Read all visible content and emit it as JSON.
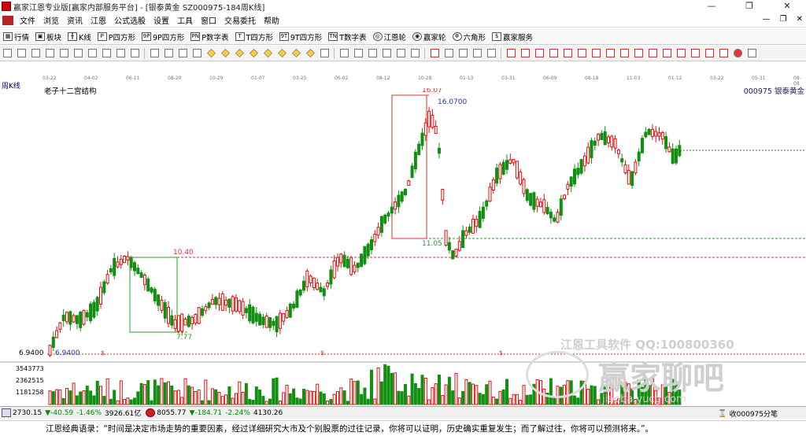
{
  "window": {
    "title": "赢家江恩专业版[赢家内部服务平台] - [银泰黄金  SZ000975-184周K线]",
    "controls": [
      "—",
      "❐",
      "✕"
    ]
  },
  "menu": {
    "items": [
      "文件",
      "浏览",
      "资讯",
      "江恩",
      "公式选股",
      "设置",
      "工具",
      "窗口",
      "交易委托",
      "帮助"
    ],
    "mdi_controls": [
      "—",
      "❐",
      "✕"
    ]
  },
  "toolbar_main": [
    {
      "icon": "grid-icon",
      "glyph": "▦",
      "label": "行情"
    },
    {
      "icon": "blocks-icon",
      "glyph": "▣",
      "label": "板块"
    },
    {
      "icon": "candle-icon",
      "glyph": "╫",
      "label": "K线"
    },
    {
      "icon": "p-square-icon",
      "glyph": "P",
      "label": "P四方形"
    },
    {
      "icon": "9p-square-icon",
      "glyph": "9P",
      "label": "9P四方形"
    },
    {
      "icon": "pn-table-icon",
      "glyph": "PN",
      "label": "P数字表"
    },
    {
      "icon": "t-square-icon",
      "glyph": "T",
      "label": "T四方形"
    },
    {
      "icon": "9t-square-icon",
      "glyph": "9T",
      "label": "9T四方形"
    },
    {
      "icon": "tn-table-icon",
      "glyph": "TN",
      "label": "T数字表"
    },
    {
      "icon": "gann-wheel-icon",
      "glyph": "◎",
      "label": "江恩轮"
    },
    {
      "icon": "winner-wheel-icon",
      "glyph": "◉",
      "label": "赢家轮"
    },
    {
      "icon": "hexagon-icon",
      "glyph": "✲",
      "label": "六角形"
    },
    {
      "icon": "dollar-icon",
      "glyph": "$",
      "label": "赢家服务"
    }
  ],
  "toolbar_draw": [
    "period-icon",
    "zoom-icon",
    "copy-icon",
    "paste-icon",
    "cut-icon",
    "undo-icon",
    "ruler-icon",
    "a-icon",
    "chart-icon",
    "flag-icon",
    "first-icon",
    "last-icon",
    "prev-icon",
    "next-icon",
    "diamond1-icon",
    "diamond2-icon",
    "diamond3-icon",
    "diamond4-icon",
    "diamond5-icon",
    "diamond6-icon",
    "diamond7-icon",
    "diamond8-icon",
    "grid-draw-icon",
    "hand-icon",
    "cross-icon",
    "line-icon",
    "fan-icon",
    "eraser-icon",
    "text-icon",
    "calc-icon",
    "save-icon",
    "print-icon",
    "mail-icon",
    "tools-icon",
    "cal1-icon",
    "cal2-icon",
    "cal3-icon",
    "cal4-icon",
    "cal5-icon",
    "cal6-icon",
    "cal7-icon",
    "cal8-icon",
    "cal9-icon",
    "cal10-icon",
    "cal11-icon",
    "cal12-icon",
    "cal13-icon",
    "cal14-icon",
    "cal15-icon",
    "cal16-icon",
    "color-wheel-icon",
    "color-icon"
  ],
  "chart": {
    "period_label": "周K线",
    "indicator_label": "老子十二宫结构",
    "stock_label": "000975 银泰黄金",
    "date_ticks": [
      "03-22",
      "04-02",
      "06-11",
      "08-20",
      "10-29",
      "01-07",
      "03-25",
      "06-02",
      "08-12",
      "10-28",
      "01-13",
      "03-31",
      "06-09",
      "08-18",
      "11-03",
      "01-12",
      "03-22",
      "05-31",
      "08-08"
    ],
    "price_labels": [
      "16.07",
      "16.0700",
      "11.05",
      "10.40",
      "7.77",
      "6.9400"
    ],
    "left_axis_price": "6.9400",
    "volume_axis": [
      "3543773",
      "2362515",
      "1181258"
    ],
    "dollar_marks": [
      "$",
      "$",
      "$",
      "$"
    ]
  },
  "chart_data": {
    "type": "candlestick",
    "title": "",
    "price_lines": [
      16.07,
      11.05,
      10.4,
      7.77,
      6.94
    ],
    "volume_ticks": [
      3543773,
      2362515,
      1181258
    ]
  },
  "status": {
    "sh_index": "2730.15",
    "sh_change": "▼-40.59",
    "sh_pct": "-1.46%",
    "sh_amount": "3926.61亿",
    "sz_index": "8055.77",
    "sz_change": "▼-184.71",
    "sz_pct": "-2.24%",
    "sz_amount": "4130.26",
    "right_text": "收000975分笔"
  },
  "quote": "江恩经典语录：“时间是决定市场走势的重要因素，经过详细研究大市及个别股票的过往记录，你将可以证明，历史确实重复发生；而了解过往，你将可以预测将来。”。",
  "watermark": {
    "software": "江恩工具软件  QQ:100800360",
    "brand": "赢家聊吧",
    "site": "jiaoba.yucg.com"
  },
  "colors": {
    "up": "#e01010",
    "down": "#109010",
    "support": "#2aa02a",
    "resistance": "#e03030"
  }
}
